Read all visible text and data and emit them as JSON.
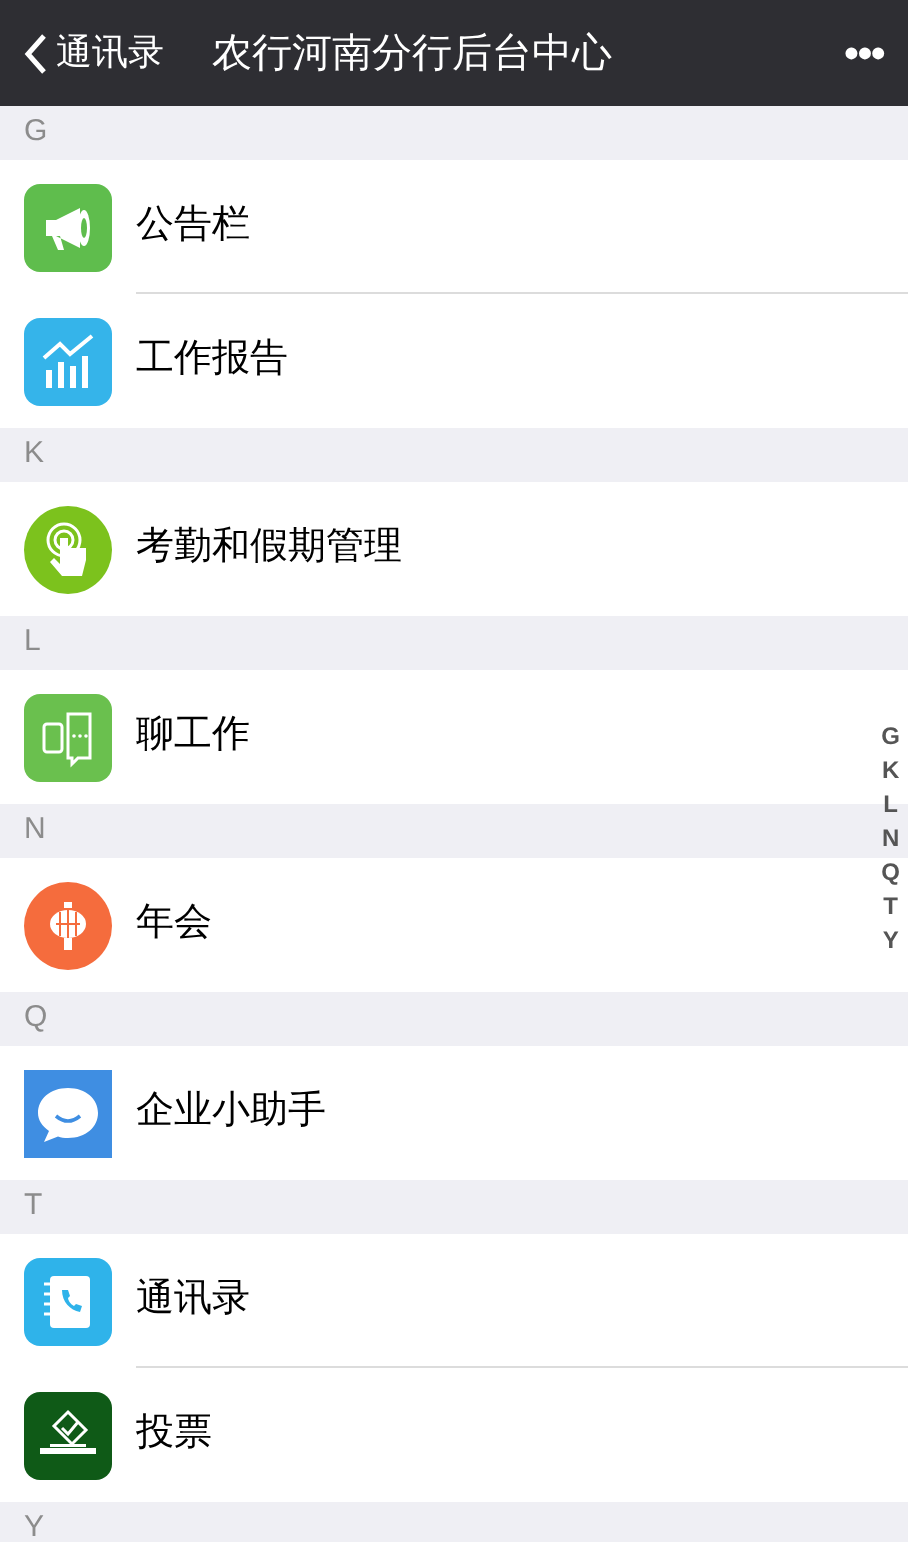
{
  "nav_bar": {
    "back_label": "通讯录",
    "title": "农行河南分行后台中心",
    "more": "•••"
  },
  "sections": [
    {
      "letter": "G",
      "items": [
        {
          "label": "公告栏"
        },
        {
          "label": "工作报告"
        }
      ]
    },
    {
      "letter": "K",
      "items": [
        {
          "label": "考勤和假期管理"
        }
      ]
    },
    {
      "letter": "L",
      "items": [
        {
          "label": "聊工作"
        }
      ]
    },
    {
      "letter": "N",
      "items": [
        {
          "label": "年会"
        }
      ]
    },
    {
      "letter": "Q",
      "items": [
        {
          "label": "企业小助手"
        }
      ]
    },
    {
      "letter": "T",
      "items": [
        {
          "label": "通讯录"
        },
        {
          "label": "投票"
        }
      ]
    },
    {
      "letter": "Y"
    }
  ],
  "index_bar": [
    "G",
    "K",
    "L",
    "N",
    "Q",
    "T",
    "Y"
  ]
}
